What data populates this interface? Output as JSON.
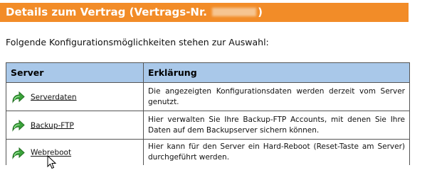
{
  "header": {
    "title_prefix": "Details zum Vertrag (Vertrags-Nr.",
    "title_suffix": ")",
    "background_color": "#f28c28"
  },
  "intro_text": "Folgende Konfigurationsmöglichkeiten stehen zur Auswahl:",
  "table": {
    "columns": [
      "Server",
      "Erklärung"
    ],
    "header_color": "#a9c8e9",
    "rows": [
      {
        "icon": "green-arrow-icon",
        "link": "Serverdaten",
        "description": "Die angezeigten Konfigurationsdaten werden derzeit vom Server genutzt."
      },
      {
        "icon": "green-arrow-icon",
        "link": "Backup-FTP",
        "description": "Hier verwalten Sie Ihre Backup-FTP Accounts, mit denen Sie Ihre Daten auf dem Backupserver sichern können."
      },
      {
        "icon": "green-arrow-icon",
        "link": "Webreboot",
        "description": "Hier kann für den Server ein Hard-Reboot (Reset-Taste am Server) durchgeführt werden."
      }
    ]
  }
}
